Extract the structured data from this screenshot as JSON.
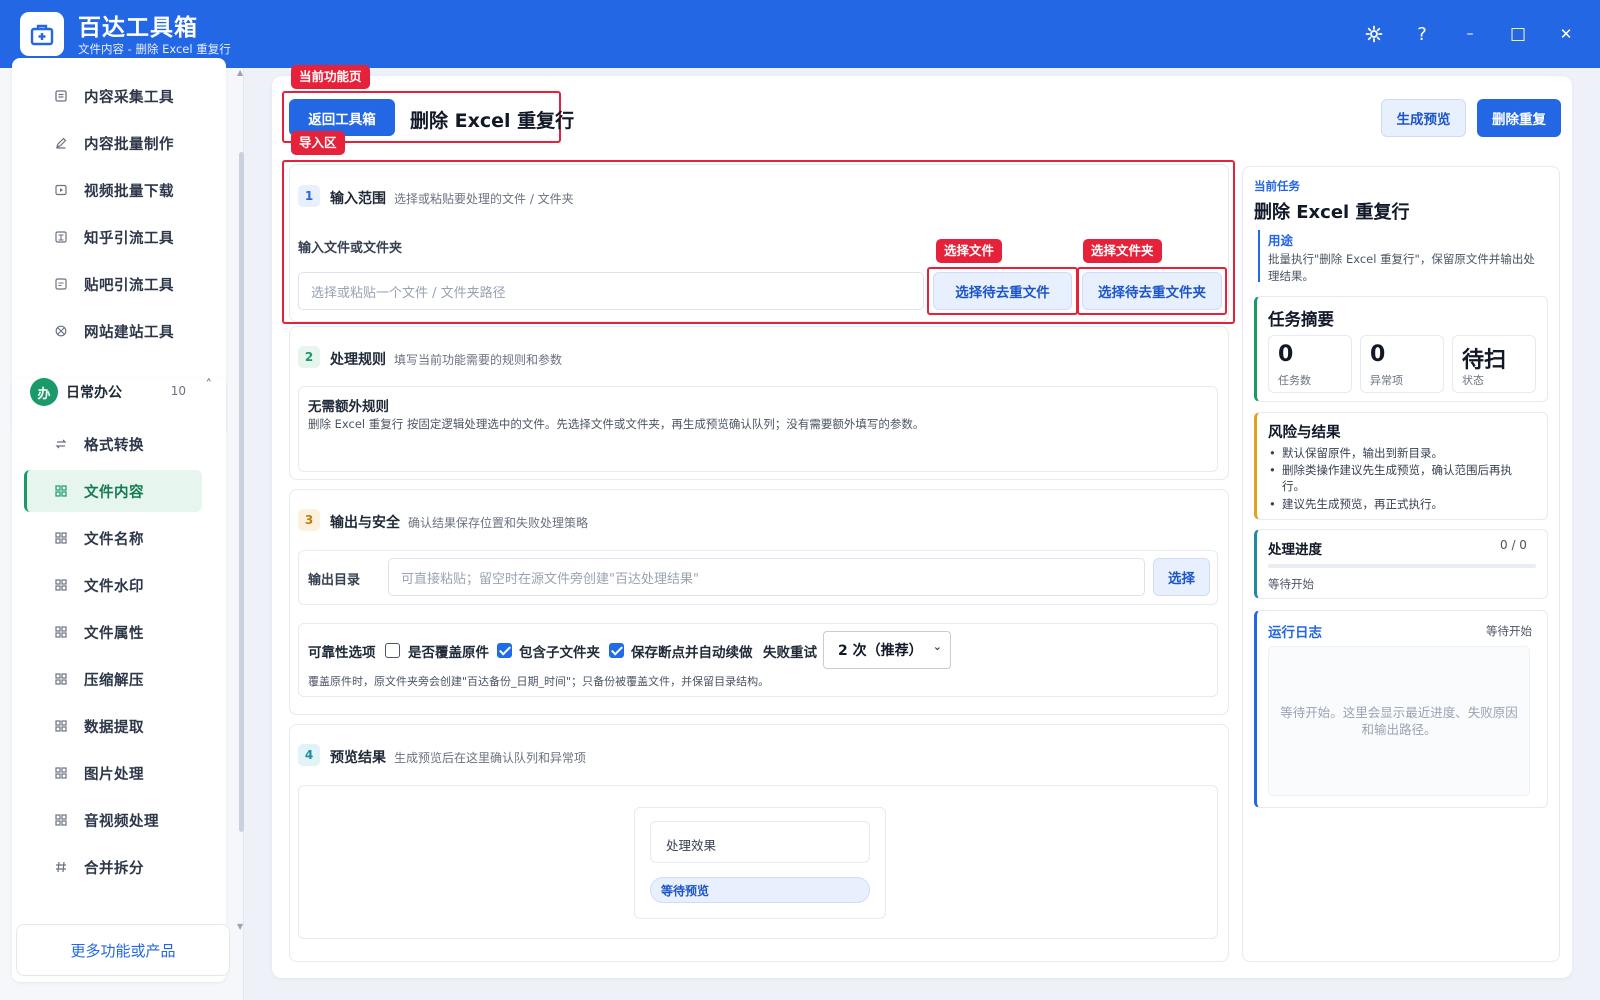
{
  "app": {
    "name": "百达工具箱",
    "subtitle": "文件内容 - 删除 Excel 重复行"
  },
  "window_controls": {
    "settings_icon": "gear-icon",
    "help_label": "?",
    "minimize_label": "–",
    "maximize_label": "□",
    "close_label": "✕"
  },
  "sidebar": {
    "group1_items": [
      {
        "label": "内容采集工具",
        "icon": "collect-icon"
      },
      {
        "label": "内容批量制作",
        "icon": "pen-icon"
      },
      {
        "label": "视频批量下载",
        "icon": "video-icon"
      },
      {
        "label": "知乎引流工具",
        "icon": "zhihu-icon"
      },
      {
        "label": "贴吧引流工具",
        "icon": "forum-icon"
      },
      {
        "label": "网站建站工具",
        "icon": "web-icon"
      }
    ],
    "group2": {
      "badge": "办",
      "title": "日常办公",
      "count": "10",
      "caret": "˄"
    },
    "group2_items": [
      {
        "label": "格式转换",
        "icon": "swap-icon"
      },
      {
        "label": "文件内容",
        "icon": "grid-icon",
        "active": true
      },
      {
        "label": "文件名称",
        "icon": "grid-icon"
      },
      {
        "label": "文件水印",
        "icon": "grid-icon"
      },
      {
        "label": "文件属性",
        "icon": "grid-icon"
      },
      {
        "label": "压缩解压",
        "icon": "grid-icon"
      },
      {
        "label": "数据提取",
        "icon": "grid-icon"
      },
      {
        "label": "图片处理",
        "icon": "grid-icon"
      },
      {
        "label": "音视频处理",
        "icon": "grid-icon"
      },
      {
        "label": "合并拆分",
        "icon": "hash-icon"
      }
    ],
    "more_label": "更多功能或产品"
  },
  "main": {
    "tags": {
      "current_page": "当前功能页",
      "import_area": "导入区",
      "select_file": "选择文件",
      "select_folder": "选择文件夹"
    },
    "back_label": "返回工具箱",
    "title": "删除 Excel 重复行",
    "preview_label": "生成预览",
    "run_label": "删除重复",
    "sections": {
      "s1": {
        "num": "1",
        "title": "输入范围",
        "desc": "选择或粘贴要处理的文件 / 文件夹",
        "field_label": "输入文件或文件夹",
        "placeholder": "选择或粘贴一个文件 / 文件夹路径",
        "pick_file": "选择待去重文件",
        "pick_folder": "选择待去重文件夹"
      },
      "s2": {
        "num": "2",
        "title": "处理规则",
        "desc": "填写当前功能需要的规则和参数",
        "rule_title": "无需额外规则",
        "rule_desc": "删除 Excel 重复行 按固定逻辑处理选中的文件。先选择文件或文件夹，再生成预览确认队列；没有需要额外填写的参数。"
      },
      "s3": {
        "num": "3",
        "title": "输出与安全",
        "desc": "确认结果保存位置和失败处理策略",
        "out_label": "输出目录",
        "out_placeholder": "可直接粘贴；留空时在源文件旁创建\"百达处理结果\"",
        "choose": "选择",
        "reliability": "可靠性选项",
        "opt_overwrite": "是否覆盖原件",
        "opt_overwrite_checked": false,
        "opt_subfolders": "包含子文件夹",
        "opt_subfolders_checked": true,
        "opt_resume": "保存断点并自动续做",
        "opt_resume_checked": true,
        "retry_label": "失败重试",
        "retry_value": "2 次（推荐）",
        "note": "覆盖原件时，原文件夹旁会创建\"百达备份_日期_时间\"；只备份被覆盖文件，并保留目录结构。"
      },
      "s4": {
        "num": "4",
        "title": "预览结果",
        "desc": "生成预览后在这里确认队列和异常项",
        "effect_label": "处理效果",
        "status_label": "等待预览"
      }
    }
  },
  "right": {
    "task_kicker": "当前任务",
    "task_title": "删除 Excel 重复行",
    "purpose_title": "用途",
    "purpose_text": "批量执行\"删除 Excel 重复行\"，保留原文件并输出处理结果。",
    "summary_title": "任务摘要",
    "stats": [
      {
        "value": "0",
        "label": "任务数"
      },
      {
        "value": "0",
        "label": "异常项"
      },
      {
        "value": "待扫",
        "label": "状态"
      }
    ],
    "risk_title": "风险与结果",
    "risk_items": [
      "默认保留原件，输出到新目录。",
      "删除类操作建议先生成预览，确认范围后再执行。",
      "建议先生成预览，再正式执行。"
    ],
    "progress_title": "处理进度",
    "progress_count": "0 / 0",
    "progress_fraction": 0,
    "progress_status": "等待开始",
    "log_title": "运行日志",
    "log_status": "等待开始",
    "log_placeholder": "等待开始。这里会显示最近进度、失败原因和输出路径。"
  },
  "colors": {
    "brand_blue": "#2467e5",
    "active_green": "#1a9a68",
    "annotation_red": "#e5223a"
  }
}
